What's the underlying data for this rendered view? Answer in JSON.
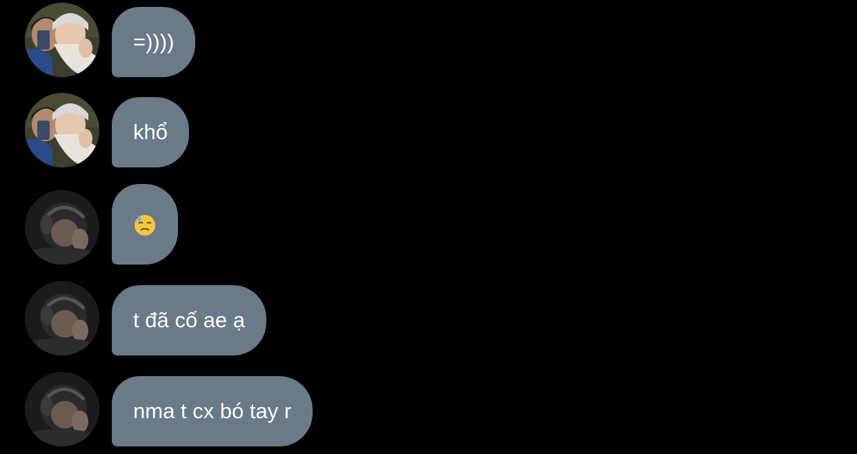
{
  "conversation": {
    "messages": [
      {
        "text": "=))))",
        "sender_avatar": "avatar-headband-photo"
      },
      {
        "text": "khổ",
        "sender_avatar": "avatar-headband-photo"
      },
      {
        "text": "",
        "emoji": "downcast-face-with-sweat-icon",
        "sender_avatar": "avatar-headphones-photo"
      },
      {
        "text": "t đã cố ae ạ",
        "sender_avatar": "avatar-headphones-photo"
      },
      {
        "text": "nma t cx bó tay r",
        "sender_avatar": "avatar-headphones-photo"
      }
    ]
  },
  "colors": {
    "background": "#000000",
    "bubble": "#6b7a89",
    "text": "#ffffff"
  }
}
